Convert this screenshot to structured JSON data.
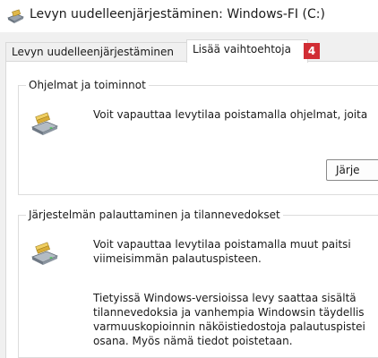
{
  "window": {
    "title": "Levyn uudelleenjärjestäminen: Windows-FI (C:)"
  },
  "tabs": [
    {
      "label": "Levyn uudelleenjärjestäminen"
    },
    {
      "label": "Lisää vaihtoehtoja"
    }
  ],
  "annotation_badge": "4",
  "programs_group": {
    "legend": "Ohjelmat ja toiminnot",
    "description": "Voit vapauttaa levytilaa poistamalla ohjelmat, joita",
    "button_label": "Järje"
  },
  "restore_group": {
    "legend": "Järjestelmän palauttaminen ja tilannevedokset",
    "description_lines": [
      "Voit vapauttaa levytilaa poistamalla muut paitsi",
      "viimeisimmän palautuspisteen."
    ],
    "note_lines": [
      "Tietyissä Windows-versioissa levy saattaa sisältä",
      "tilannevedoksia ja vanhempia Windowsin täydellis",
      "varmuuskopioinnin näköistiedostoja palautuspistei",
      "osana. Myös nämä tiedot poistetaan."
    ]
  }
}
